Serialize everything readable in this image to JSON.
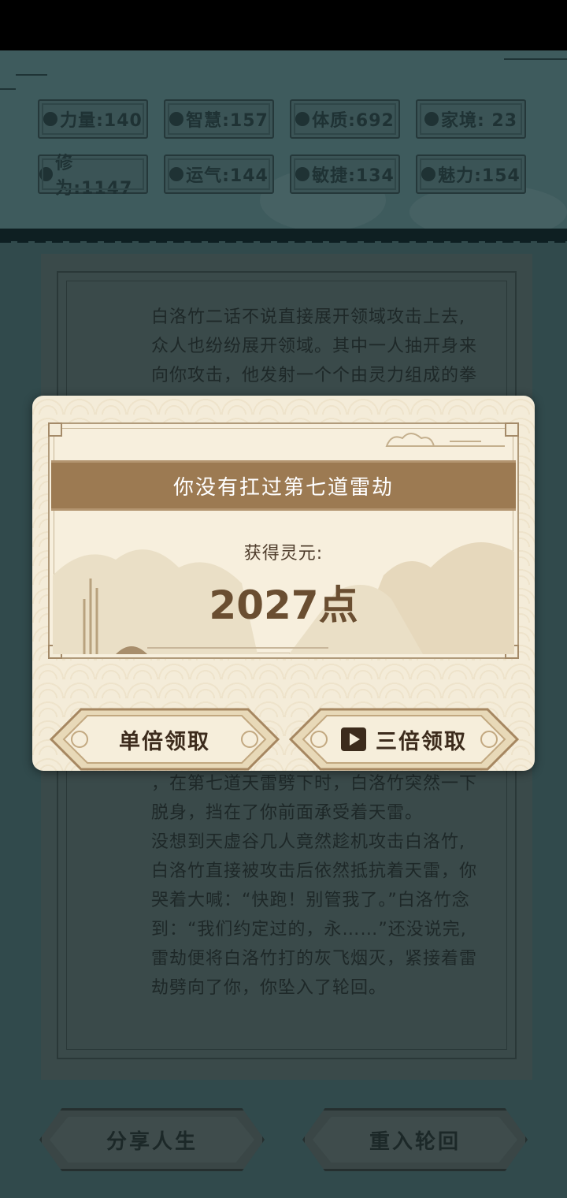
{
  "stats": [
    {
      "icon": "strength-icon",
      "label": "力量:140"
    },
    {
      "icon": "wisdom-icon",
      "label": "智慧:157"
    },
    {
      "icon": "constitution-icon",
      "label": "体质:692"
    },
    {
      "icon": "family-icon",
      "label": "家境: 23"
    },
    {
      "icon": "cultivation-icon",
      "label": "修为:1147"
    },
    {
      "icon": "luck-icon",
      "label": "运气:144"
    },
    {
      "icon": "agility-icon",
      "label": "敏捷:134"
    },
    {
      "icon": "charm-icon",
      "label": "魅力:154"
    }
  ],
  "story": {
    "top_lines": [
      "白洛竹二话不说直接展开领域攻击上去,",
      "众人也纷纷展开领域。其中一人抽开身来",
      "向你攻击，他发射一个个由灵力组成的拳"
    ],
    "bottom_lines": [
      "，在第七道天雷劈下时，白洛竹突然一下",
      "脱身，挡在了你前面承受着天雷。",
      "没想到天虚谷几人竟然趁机攻击白洛竹,",
      "白洛竹直接被攻击后依然抵抗着天雷，你",
      "哭着大喊：“快跑！别管我了。”白洛竹念",
      "到：“我们约定过的，永……”还没说完,",
      "雷劫便将白洛竹打的灰飞烟灭，紧接着雷",
      "劫劈向了你，你坠入了轮回。"
    ]
  },
  "bottom_buttons": {
    "share": "分享人生",
    "reincarnate": "重入轮回"
  },
  "modal": {
    "title": "你没有扛过第七道雷劫",
    "reward_label": "获得灵元:",
    "reward_value": "2027点",
    "single_button": "单倍领取",
    "triple_button": "三倍领取",
    "triple_icon": "video-play-icon"
  },
  "colors": {
    "modal_bg": "#f4ecd9",
    "title_band": "#9c7a52",
    "scene_bg": "#314a4c"
  }
}
